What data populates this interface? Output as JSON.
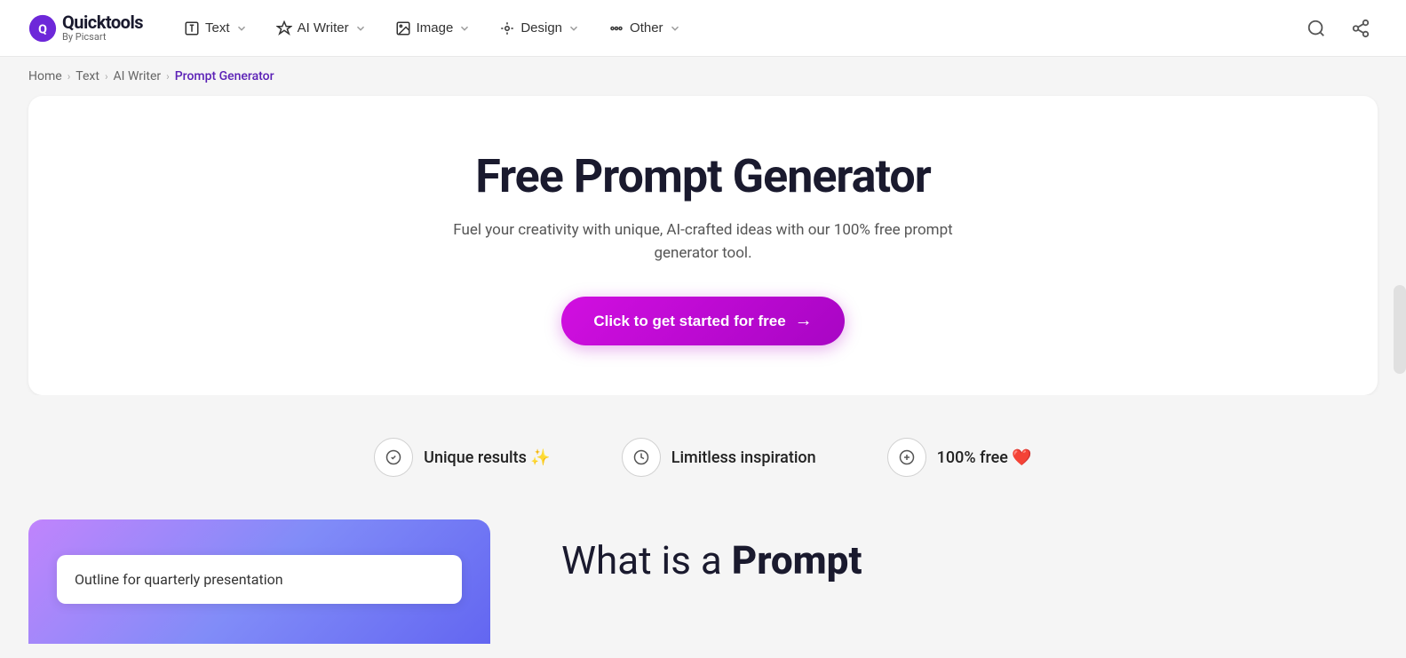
{
  "logo": {
    "main": "Quicktools",
    "sub": "By Picsart"
  },
  "nav": {
    "items": [
      {
        "id": "text",
        "label": "Text",
        "icon": "text-icon"
      },
      {
        "id": "ai-writer",
        "label": "AI Writer",
        "icon": "ai-writer-icon"
      },
      {
        "id": "image",
        "label": "Image",
        "icon": "image-icon"
      },
      {
        "id": "design",
        "label": "Design",
        "icon": "design-icon"
      },
      {
        "id": "other",
        "label": "Other",
        "icon": "other-icon"
      }
    ],
    "search_label": "Search",
    "share_label": "Share"
  },
  "breadcrumb": {
    "items": [
      {
        "label": "Home",
        "active": false
      },
      {
        "label": "Text",
        "active": false
      },
      {
        "label": "AI Writer",
        "active": false
      },
      {
        "label": "Prompt Generator",
        "active": true
      }
    ]
  },
  "hero": {
    "title": "Free Prompt Generator",
    "subtitle": "Fuel your creativity with unique, AI-crafted ideas with our 100% free prompt generator tool.",
    "cta_label": "Click to get started for free",
    "cta_arrow": "→"
  },
  "features": [
    {
      "id": "unique",
      "label": "Unique results ✨",
      "icon": "✓"
    },
    {
      "id": "limitless",
      "label": "Limitless inspiration",
      "icon": "⏱"
    },
    {
      "id": "free",
      "label": "100% free ❤️",
      "icon": "◎"
    }
  ],
  "bottom": {
    "input_placeholder": "Outline for quarterly presentation",
    "what_is_title_normal": "What is a ",
    "what_is_title_bold": "Prompt"
  },
  "colors": {
    "brand_purple": "#c026d3",
    "logo_circle": "#5b21b6",
    "accent": "#a21caf"
  }
}
